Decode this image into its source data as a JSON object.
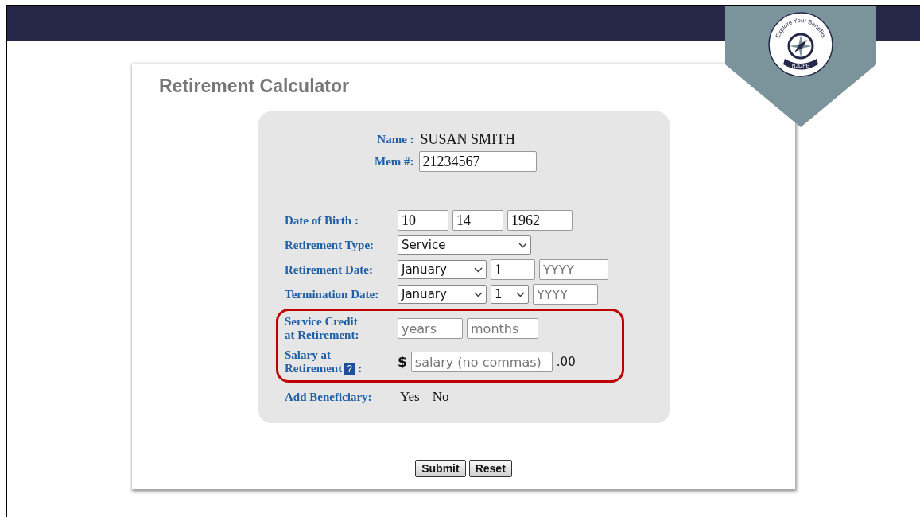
{
  "logo": {
    "tagline": "Explore Your Benefits",
    "org": "NJDPB"
  },
  "card": {
    "title": "Retirement Calculator"
  },
  "member": {
    "name_label": "Name :",
    "name": "SUSAN SMITH",
    "mem_label": "Mem #:",
    "mem_value": "21234567"
  },
  "sections": [
    {
      "highlighted": false,
      "rows": [
        {
          "label_lines": [
            "Date of Birth :"
          ],
          "controls": [
            {
              "kind": "input",
              "value": "10"
            },
            {
              "kind": "input",
              "value": "14"
            },
            {
              "kind": "input",
              "value": "1962"
            }
          ]
        },
        {
          "label_lines": [
            "Retirement Type:"
          ],
          "controls": [
            {
              "kind": "select",
              "value": "Service"
            }
          ]
        },
        {
          "label_lines": [
            "Retirement Date:"
          ],
          "controls": [
            {
              "kind": "select",
              "value": "January"
            },
            {
              "kind": "input",
              "value": "1"
            },
            {
              "kind": "input",
              "placeholder": "YYYY"
            }
          ]
        },
        {
          "label_lines": [
            "Termination Date:"
          ],
          "controls": [
            {
              "kind": "select",
              "value": "January"
            },
            {
              "kind": "select",
              "value": "1"
            },
            {
              "kind": "input",
              "placeholder": "YYYY"
            }
          ]
        }
      ]
    },
    {
      "highlighted": true,
      "rows": [
        {
          "label_lines": [
            "Service Credit",
            "at Retirement:"
          ],
          "controls": [
            {
              "kind": "input",
              "placeholder": "years"
            },
            {
              "kind": "input",
              "placeholder": "months"
            }
          ]
        },
        {
          "label_lines": [
            "Salary at",
            "Retirement"
          ],
          "help": "?",
          "label_suffix": ":",
          "controls": [
            {
              "kind": "text",
              "value": "$"
            },
            {
              "kind": "input",
              "placeholder": "salary (no commas)"
            },
            {
              "kind": "text",
              "value": ".00"
            }
          ]
        }
      ]
    },
    {
      "highlighted": false,
      "rows": [
        {
          "label_lines": [
            "Add Beneficiary:"
          ],
          "controls": [
            {
              "kind": "link",
              "value": "Yes"
            },
            {
              "kind": "link",
              "value": "No"
            }
          ]
        }
      ]
    }
  ],
  "buttons": [
    "Submit",
    "Reset"
  ]
}
